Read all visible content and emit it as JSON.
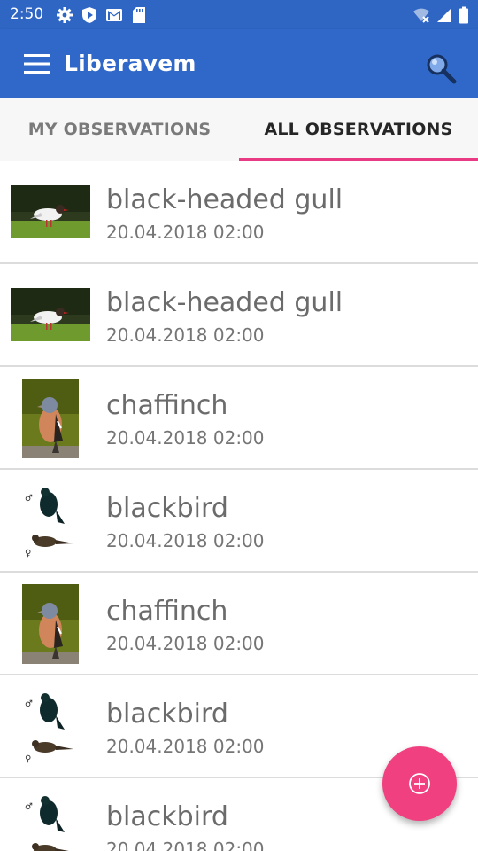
{
  "status_bar": {
    "time": "2:50",
    "left_icons": [
      "settings-icon",
      "shield-play-icon",
      "gmail-icon",
      "sd-card-icon"
    ],
    "right_icons": [
      "wifi-off-icon",
      "signal-icon",
      "battery-icon"
    ]
  },
  "app_bar": {
    "title": "Liberavem",
    "menu_icon": "menu-icon",
    "search_icon": "search-icon",
    "color": "#3068c9"
  },
  "tabs": [
    {
      "label": "MY OBSERVATIONS",
      "active": false
    },
    {
      "label": "ALL OBSERVATIONS",
      "active": true
    }
  ],
  "accent_color": "#e93b83",
  "observations": [
    {
      "name": "black-headed gull",
      "date": "20.04.2018 02:00",
      "image": "black-headed-gull-photo"
    },
    {
      "name": "black-headed gull",
      "date": "20.04.2018 02:00",
      "image": "black-headed-gull-photo"
    },
    {
      "name": "chaffinch",
      "date": "20.04.2018 02:00",
      "image": "chaffinch-photo"
    },
    {
      "name": "blackbird",
      "date": "20.04.2018 02:00",
      "image": "blackbird-illustration"
    },
    {
      "name": "chaffinch",
      "date": "20.04.2018 02:00",
      "image": "chaffinch-photo"
    },
    {
      "name": "blackbird",
      "date": "20.04.2018 02:00",
      "image": "blackbird-illustration"
    },
    {
      "name": "blackbird",
      "date": "20.04.2018 02:00",
      "image": "blackbird-illustration"
    }
  ],
  "fab": {
    "icon": "add-circle-icon",
    "color": "#f0407f"
  }
}
